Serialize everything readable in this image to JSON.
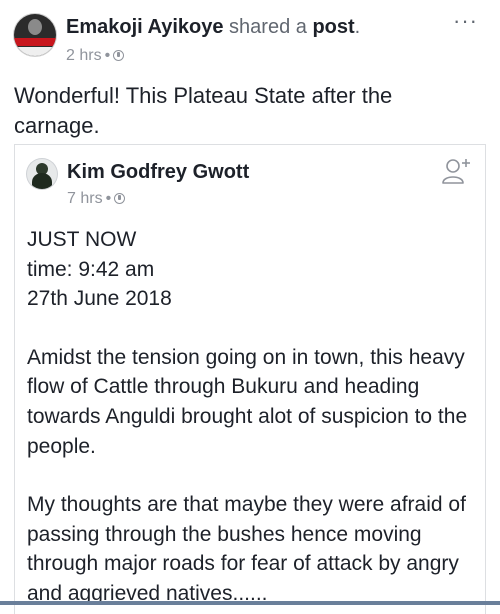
{
  "post": {
    "author": "Emakoji Ayikoye",
    "shared_text": "shared a",
    "post_word": "post",
    "period": ".",
    "time": "2 hrs",
    "more_label": "···",
    "caption": "Wonderful! This Plateau State after the carnage."
  },
  "shared": {
    "author": "Kim Godfrey Gwott",
    "time": "7 hrs",
    "lines": {
      "headline": "JUST NOW",
      "time_line": "time: 9:42 am",
      "date_line": "27th June 2018",
      "para1": "Amidst the tension going on in town, this heavy flow of Cattle through Bukuru and heading towards Anguldi brought alot of suspicion to the people.",
      "para2": "My thoughts are that maybe they were afraid of passing through the bushes hence moving through major roads for fear of attack by angry and aggrieved natives......"
    }
  },
  "icons": {
    "privacy": "globe-icon",
    "more": "more-options-icon",
    "follow": "add-friend-icon"
  },
  "colors": {
    "text": "#1d2129",
    "meta": "#90949c",
    "border": "#dddfe2",
    "bottom_bar": "#6a7f9a"
  }
}
